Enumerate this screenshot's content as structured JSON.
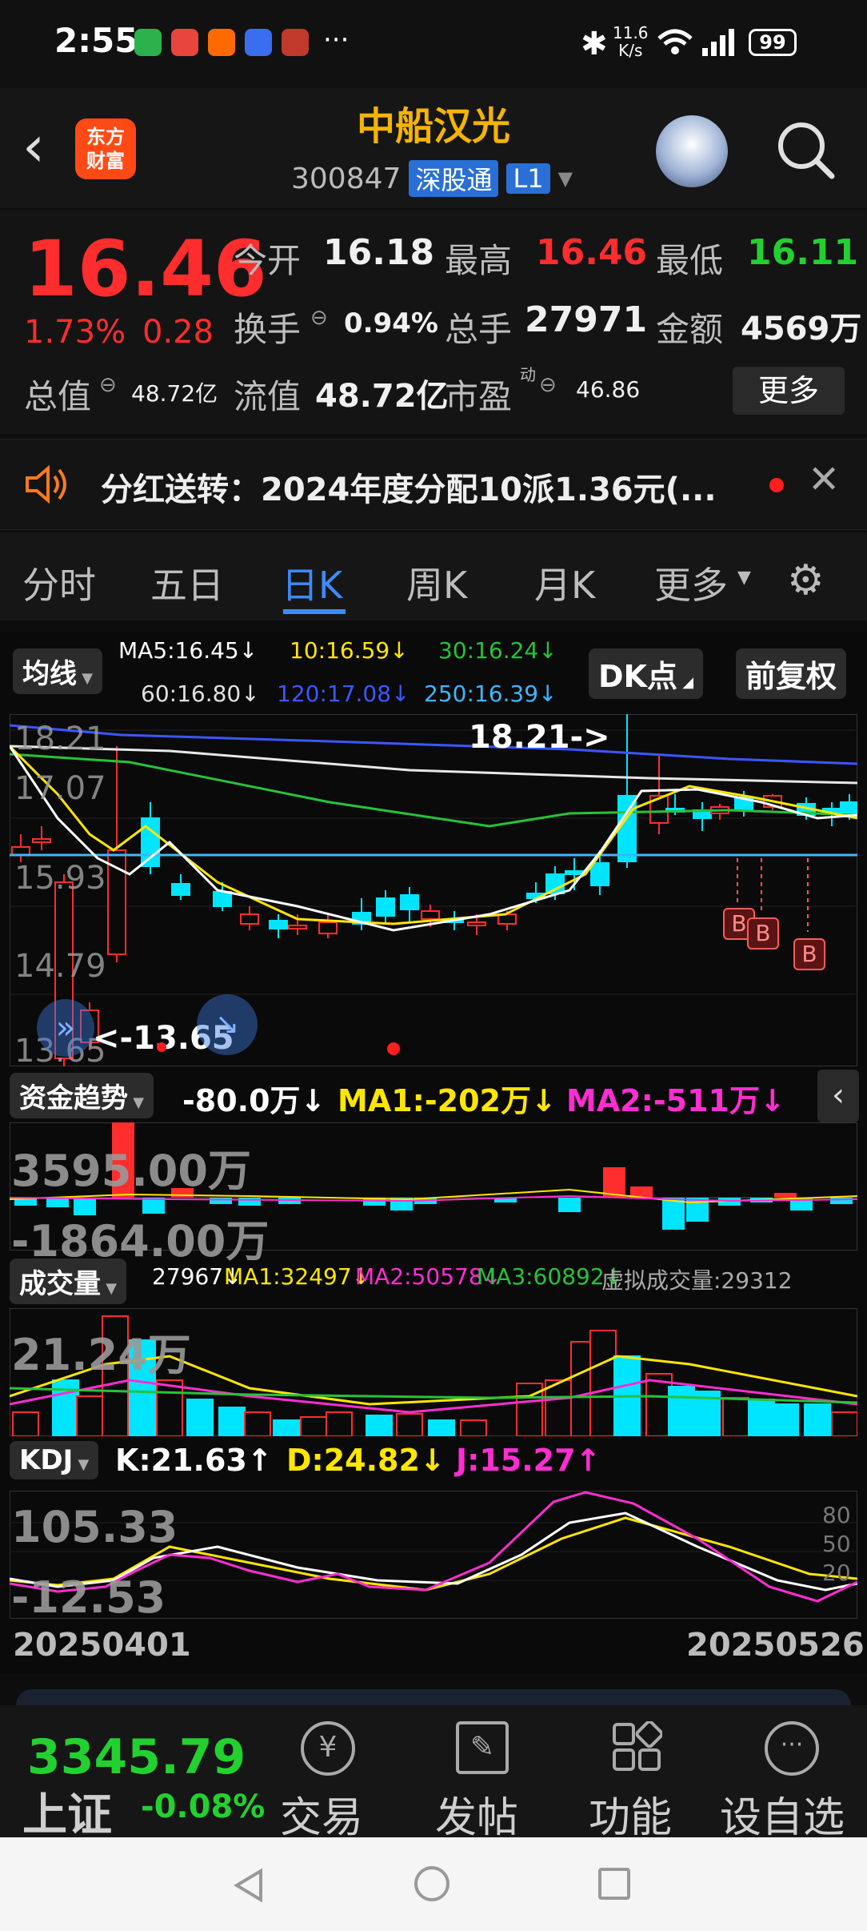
{
  "status": {
    "time": "2:55",
    "net_speed": "11.6\nK/s",
    "net_speed_top": "11.6",
    "net_speed_bottom": "K/s",
    "battery": "99",
    "sim": "6"
  },
  "header": {
    "title": "中船汉光",
    "code": "300847",
    "tag1": "深股通",
    "tag2": "L1",
    "logo_text_1": "东方",
    "logo_text_2": "财富"
  },
  "quote": {
    "price": "16.46",
    "change_pct": "1.73%",
    "change": "0.28",
    "open_label": "今开",
    "open": "16.18",
    "high_label": "最高",
    "high": "16.46",
    "low_label": "最低",
    "low": "16.11",
    "turnover_label": "换手",
    "turnover": "0.94%",
    "volume_label": "总手",
    "volume": "27971",
    "amount_label": "金额",
    "amount": "4569万",
    "mktcap_label": "总值",
    "mktcap": "48.72亿",
    "float_label": "流值",
    "float": "48.72亿",
    "pe_label": "市盈",
    "pe_sup": "动",
    "pe": "46.86",
    "more_button": "更多"
  },
  "notice": {
    "text": "分红送转：2024年度分配10派1.36元(..."
  },
  "tabs": [
    "分时",
    "五日",
    "日K",
    "周K",
    "月K",
    "更多"
  ],
  "active_tab": "日K",
  "kline": {
    "ma_selector": "均线",
    "ma5": "MA5:16.45↓",
    "ma10": "10:16.59↓",
    "ma30": "30:16.24↓",
    "ma60": "60:16.80↓",
    "ma120": "120:17.08↓",
    "ma250": "250:16.39↓",
    "dk_button": "DK点",
    "adjust_button": "前复权",
    "y_labels": [
      "18.21",
      "17.07",
      "15.93",
      "14.79",
      "13.65"
    ],
    "high_marker": "18.21->",
    "low_marker": "<-13.65",
    "b_marker": "B",
    "colors": {
      "ma5": "#ffffff",
      "ma10": "#ffe600",
      "ma30": "#27c23a",
      "ma60": "#e8e8e8",
      "ma120": "#3b57ff",
      "ma250": "#3fb6ff",
      "up": "#ff2d2d",
      "down": "#00e5ff"
    }
  },
  "fund": {
    "selector": "资金趋势",
    "value": "-80.0万↓",
    "ma1": "MA1:-202万↓",
    "ma2": "MA2:-511万↓",
    "y_top": "3595.00万",
    "y_bottom": "-1864.00万"
  },
  "volume": {
    "selector": "成交量",
    "value": "27967↓",
    "ma1": "MA1:32497↓",
    "ma2": "MA2:50578↓",
    "ma3": "MA3:60892↓",
    "virtual": "虚拟成交量:29312",
    "y_top": "21.24万"
  },
  "kdj": {
    "selector": "KDJ",
    "k": "K:21.63↑",
    "d": "D:24.82↓",
    "j": "J:15.27↑",
    "y_top": "105.33",
    "y_bottom": "-12.53",
    "levels": [
      "80",
      "50",
      "20"
    ]
  },
  "dates": {
    "start": "20250401",
    "end": "20250526"
  },
  "bottom": {
    "index_value": "3345.79",
    "index_name": "上证",
    "index_change": "-0.08%",
    "nav": [
      "交易",
      "发帖",
      "功能",
      "设自选"
    ]
  }
}
